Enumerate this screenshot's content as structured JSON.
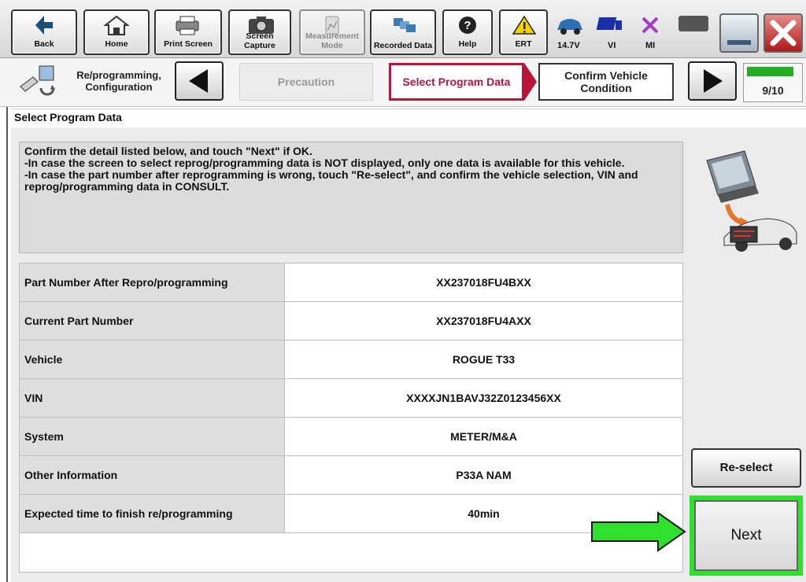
{
  "toolbar": {
    "buttons": [
      {
        "label": "Back",
        "icon": "back-arrow-icon"
      },
      {
        "label": "Home",
        "icon": "home-icon"
      },
      {
        "label": "Print Screen",
        "icon": "printer-icon"
      },
      {
        "label": "Screen Capture",
        "icon": "camera-icon"
      },
      {
        "label": "Measurement Mode",
        "icon": "measurement-icon",
        "disabled": true
      },
      {
        "label": "Recorded Data",
        "icon": "recorded-data-icon"
      },
      {
        "label": "Help",
        "icon": "help-icon"
      },
      {
        "label": "ERT",
        "icon": "warning-icon"
      }
    ],
    "status": {
      "voltage": "14.7V",
      "vi": "VI",
      "mi": "MI"
    }
  },
  "stepbar": {
    "mode_label": "Re/programming, Configuration",
    "steps": [
      "Precaution",
      "Select Program Data",
      "Confirm Vehicle Condition"
    ],
    "active_step": "Select Program Data",
    "progress_text": "9/10",
    "progress_fraction": 0.9
  },
  "page": {
    "title": "Select Program Data",
    "message_lines": [
      "Confirm the detail listed below, and touch \"Next\" if OK.",
      "-In case the screen to select reprog/programming data is NOT displayed, only one data is available for this vehicle.",
      "-In case the part number after reprogramming is wrong, touch \"Re-select\", and confirm the vehicle selection, VIN and reprog/programming data in CONSULT."
    ]
  },
  "table": {
    "rows": [
      {
        "label": "Part Number After Repro/programming",
        "value": "XX237018FU4BXX"
      },
      {
        "label": "Current Part Number",
        "value": "XX237018FU4AXX"
      },
      {
        "label": "Vehicle",
        "value": "ROGUE T33"
      },
      {
        "label": "VIN",
        "value": "XXXXJN1BAVJ32Z0123456XX"
      },
      {
        "label": "System",
        "value": "METER/M&A"
      },
      {
        "label": "Other Information",
        "value": "P33A NAM"
      },
      {
        "label": "Expected time to finish re/programming",
        "value": "40min"
      }
    ]
  },
  "actions": {
    "reselect": "Re-select",
    "next": "Next"
  },
  "colors": {
    "active_step": "#b9143a",
    "highlight": "#2fe02f",
    "progress": "#22b022"
  }
}
